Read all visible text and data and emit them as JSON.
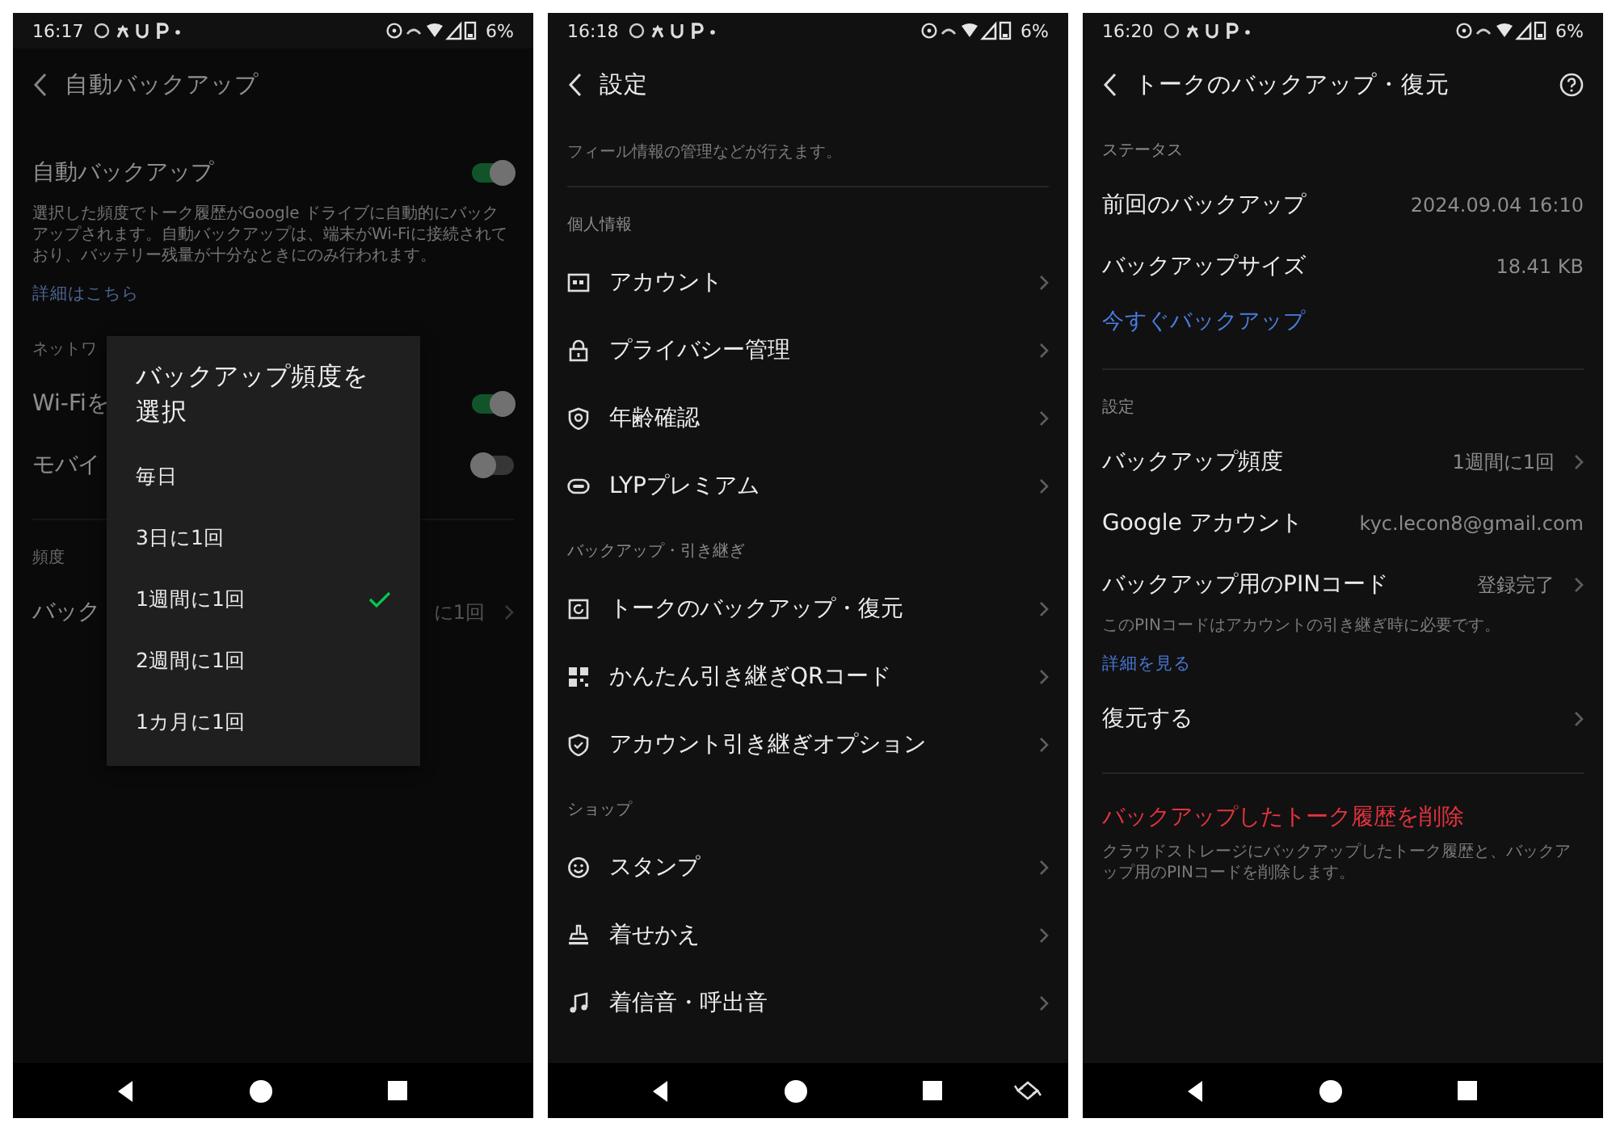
{
  "screens": [
    {
      "status_bar": {
        "time": "16:17",
        "battery": "6%"
      },
      "header": {
        "title": "自動バックアップ",
        "help": false
      },
      "groups": [
        {
          "divider": false,
          "items": [
            {
              "kind": "toggle",
              "label": "自動バックアップ",
              "on": true
            },
            {
              "kind": "note",
              "text": "選択した頻度でトーク履歴がGoogle ドライブに自動的にバックアップされます。自動バックアップは、端末がWi-Fiに接続されており、バッテリー残量が十分なときにのみ行われます。"
            },
            {
              "kind": "link",
              "text": "詳細はこちら"
            }
          ]
        },
        {
          "divider": false,
          "label": "ネットワ",
          "items": [
            {
              "kind": "toggle",
              "label": "Wi-Fiを",
              "on": true
            },
            {
              "kind": "toggle",
              "label": "モバイ",
              "on": false
            }
          ]
        },
        {
          "divider": true,
          "label": "頻度",
          "items": [
            {
              "kind": "value",
              "label": "バック",
              "value": "に1回",
              "chevron": true
            }
          ]
        }
      ],
      "dialog": {
        "title": "バックアップ頻度を選択",
        "options": [
          {
            "label": "毎日",
            "selected": false
          },
          {
            "label": "3日に1回",
            "selected": false
          },
          {
            "label": "1週間に1回",
            "selected": true
          },
          {
            "label": "2週間に1回",
            "selected": false
          },
          {
            "label": "1カ月に1回",
            "selected": false
          }
        ]
      },
      "nav_bar": {
        "rotate": false
      }
    },
    {
      "status_bar": {
        "time": "16:18",
        "battery": "6%"
      },
      "header": {
        "title": "設定",
        "help": false
      },
      "groups": [
        {
          "divider": false,
          "items": [
            {
              "kind": "note",
              "text": "フィール情報の管理などが行えます。"
            }
          ]
        },
        {
          "divider": true,
          "label": "個人情報",
          "items": [
            {
              "kind": "nav",
              "label": "アカウント"
            },
            {
              "kind": "nav",
              "label": "プライバシー管理"
            },
            {
              "kind": "nav",
              "label": "年齢確認"
            },
            {
              "kind": "nav",
              "label": "LYPプレミアム"
            }
          ]
        },
        {
          "divider": false,
          "label": "バックアップ・引き継ぎ",
          "items": [
            {
              "kind": "nav",
              "label": "トークのバックアップ・復元"
            },
            {
              "kind": "nav",
              "label": "かんたん引き継ぎQRコード"
            },
            {
              "kind": "nav",
              "label": "アカウント引き継ぎオプション"
            }
          ]
        },
        {
          "divider": false,
          "label": "ショップ",
          "items": [
            {
              "kind": "nav",
              "label": "スタンプ"
            },
            {
              "kind": "nav",
              "label": "着せかえ"
            },
            {
              "kind": "nav",
              "label": "着信音・呼出音"
            }
          ]
        }
      ],
      "nav_bar": {
        "rotate": true
      }
    },
    {
      "status_bar": {
        "time": "16:20",
        "battery": "6%"
      },
      "header": {
        "title": "トークのバックアップ・復元",
        "help": true
      },
      "groups": [
        {
          "divider": false,
          "label": "ステータス",
          "items": [
            {
              "kind": "value",
              "label": "前回のバックアップ",
              "value": "2024.09.04 16:10",
              "chevron": false
            },
            {
              "kind": "value",
              "label": "バックアップサイズ",
              "value": "18.41 KB",
              "chevron": false
            },
            {
              "kind": "action",
              "text": "今すぐバックアップ"
            }
          ]
        },
        {
          "divider": true,
          "label": "設定",
          "items": [
            {
              "kind": "value",
              "label": "バックアップ頻度",
              "value": "1週間に1回",
              "chevron": true
            },
            {
              "kind": "value",
              "label": "Google アカウント",
              "value": "kyc.lecon8@gmail.com",
              "chevron": false
            },
            {
              "kind": "value",
              "label": "バックアップ用のPINコード",
              "value": "登録完了",
              "chevron": true
            },
            {
              "kind": "note",
              "text": "このPINコードはアカウントの引き継ぎ時に必要です。"
            },
            {
              "kind": "link",
              "text": "詳細を見る"
            },
            {
              "kind": "value",
              "label": "復元する",
              "chevron": true
            }
          ]
        },
        {
          "divider": true,
          "items": [
            {
              "kind": "danger",
              "text": "バックアップしたトーク履歴を削除"
            },
            {
              "kind": "note",
              "text": "クラウドストレージにバックアップしたトーク履歴と、バックアップ用のPINコードを削除します。"
            }
          ]
        }
      ],
      "nav_bar": {
        "rotate": false
      }
    }
  ]
}
